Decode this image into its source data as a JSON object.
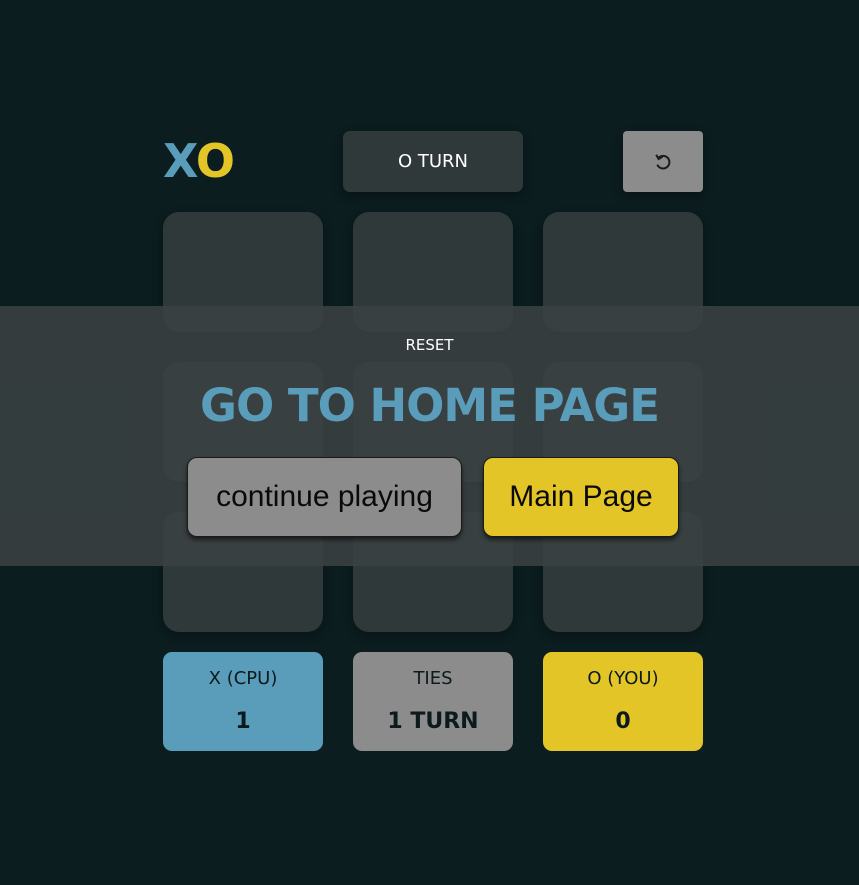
{
  "header": {
    "logo_x": "X",
    "logo_o": "O",
    "turn_label": "O TURN",
    "restart_icon": "restart-icon"
  },
  "board": {
    "cells": [
      "",
      "",
      "",
      "",
      "",
      "",
      "",
      "",
      ""
    ]
  },
  "scores": {
    "x_label": "X (CPU)",
    "x_value": "1",
    "ties_label": "TIES",
    "ties_value": "1 TURN",
    "o_label": "O (YOU)",
    "o_value": "0"
  },
  "modal": {
    "subtitle": "RESET",
    "title": "GO TO HOME PAGE",
    "continue_label": "continue playing",
    "main_label": "Main Page"
  },
  "colors": {
    "background": "#0b1d1f",
    "x_accent": "#5a9dbb",
    "o_accent": "#e4c528",
    "cell": "#30393a",
    "neutral": "#8c8c8c"
  }
}
